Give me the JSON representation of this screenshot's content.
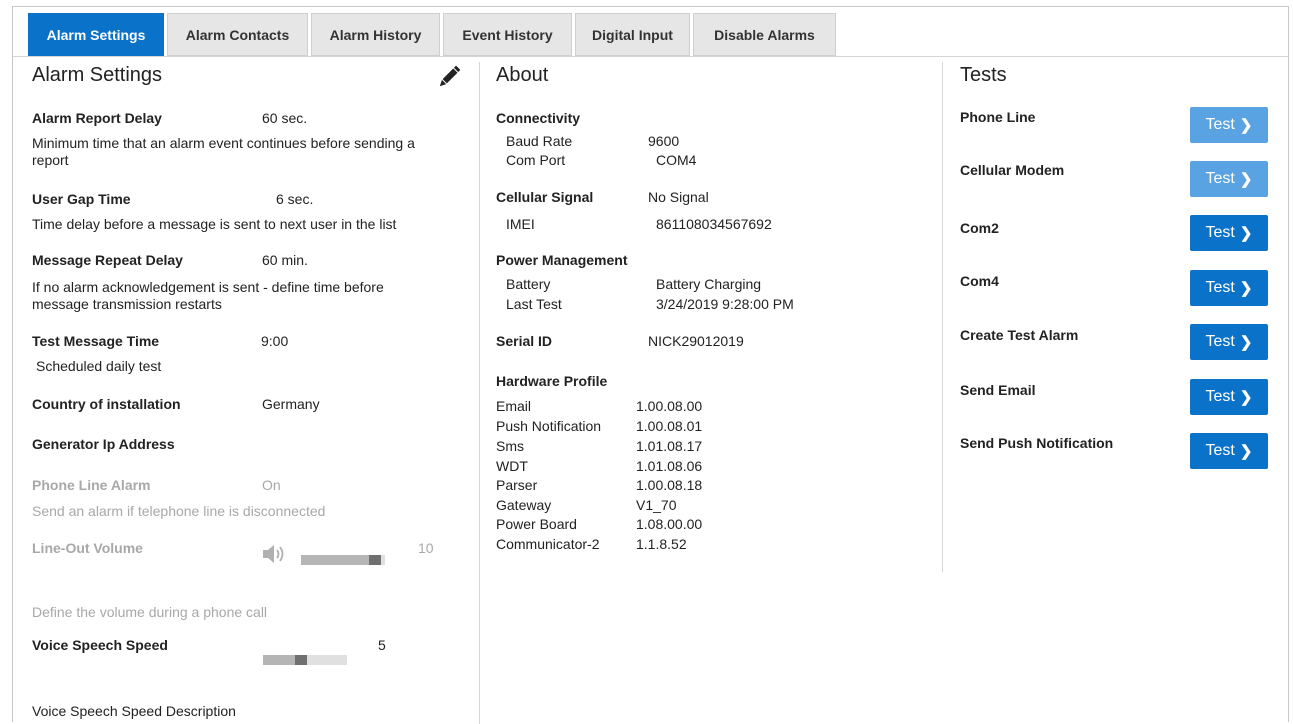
{
  "tabs": [
    {
      "label": "Alarm Settings",
      "active": true
    },
    {
      "label": "Alarm Contacts",
      "active": false
    },
    {
      "label": "Alarm History",
      "active": false
    },
    {
      "label": "Event History",
      "active": false
    },
    {
      "label": "Digital Input",
      "active": false
    },
    {
      "label": "Disable Alarms",
      "active": false
    }
  ],
  "alarm_settings": {
    "title": "Alarm Settings",
    "edit_icon": "pencil-icon",
    "report_delay": {
      "label": "Alarm Report Delay",
      "value": "60 sec.",
      "description": "Minimum time that an alarm event continues before sending a report",
      "desc_line1": "Minimum time that an alarm event continues before sending a",
      "desc_line2": "report"
    },
    "user_gap": {
      "label": "User Gap Time",
      "value": "6 sec.",
      "description": "Time delay before a message is sent to next user in the list"
    },
    "repeat_delay": {
      "label": "Message Repeat Delay",
      "value": "60 min.",
      "description": "If no alarm acknowledgement is sent - define time before message transmission restarts",
      "desc_line1": "If no alarm acknowledgement is sent - define time before",
      "desc_line2": "message transmission restarts"
    },
    "test_message": {
      "label": "Test Message Time",
      "value": "9:00",
      "description": "Scheduled daily test"
    },
    "country": {
      "label": "Country of installation",
      "value": "Germany"
    },
    "generator_ip": {
      "label": "Generator Ip Address",
      "value": ""
    },
    "phone_line_alarm": {
      "label": "Phone Line Alarm",
      "value": "On",
      "description": "Send an alarm if telephone line is disconnected"
    },
    "line_out_volume": {
      "label": "Line-Out Volume",
      "value": "10",
      "level_fraction": 0.95,
      "icon": "speaker-icon",
      "description": "Define the volume during a phone call"
    },
    "voice_speed": {
      "label": "Voice Speech Speed",
      "value": "5",
      "level_fraction": 0.45,
      "description": "Voice Speech Speed Description"
    }
  },
  "about": {
    "title": "About",
    "connectivity": {
      "heading": "Connectivity",
      "baud_label": "Baud Rate",
      "baud_value": "9600",
      "port_label": "Com Port",
      "port_value": "COM4"
    },
    "cellular": {
      "heading": "Cellular Signal",
      "value": "No Signal",
      "imei_label": "IMEI",
      "imei_value": "861108034567692"
    },
    "power": {
      "heading": "Power Management",
      "battery_label": "Battery",
      "battery_value": "Battery Charging",
      "last_test_label": "Last Test",
      "last_test_value": "3/24/2019 9:28:00 PM"
    },
    "serial": {
      "label": "Serial ID",
      "value": "NICK29012019"
    },
    "hardware": {
      "heading": "Hardware Profile",
      "items": [
        {
          "name": "Email",
          "version": "1.00.08.00"
        },
        {
          "name": "Push Notification",
          "version": "1.00.08.01"
        },
        {
          "name": "Sms",
          "version": "1.01.08.17"
        },
        {
          "name": "WDT",
          "version": "1.01.08.06"
        },
        {
          "name": "Parser",
          "version": "1.00.08.18"
        },
        {
          "name": "Gateway",
          "version": "V1_70"
        },
        {
          "name": "Power Board",
          "version": "1.08.00.00"
        },
        {
          "name": "Communicator-2",
          "version": "1.1.8.52"
        }
      ]
    }
  },
  "tests": {
    "title": "Tests",
    "button_label": "Test",
    "button_icon": "chevron-right-icon",
    "items": [
      {
        "label": "Phone Line",
        "enabled": false
      },
      {
        "label": "Cellular Modem",
        "enabled": false
      },
      {
        "label": "Com2",
        "enabled": true
      },
      {
        "label": "Com4",
        "enabled": true
      },
      {
        "label": "Create Test Alarm",
        "enabled": true
      },
      {
        "label": "Send Email",
        "enabled": true
      },
      {
        "label": "Send Push Notification",
        "enabled": true
      }
    ]
  },
  "colors": {
    "accent": "#0b72c9",
    "accent_disabled": "#5aa3e2",
    "tab_inactive": "#e6e6e6",
    "muted_text": "#a8a8a8"
  }
}
